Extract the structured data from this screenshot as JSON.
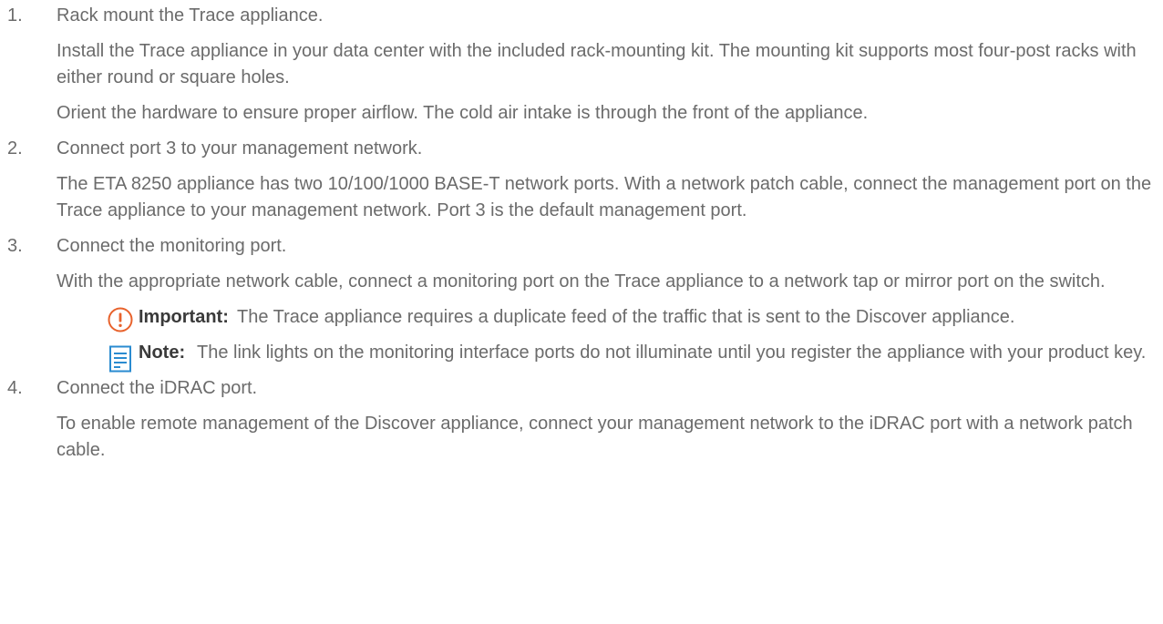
{
  "steps": [
    {
      "number": "1.",
      "title": "Rack mount the Trace appliance.",
      "paragraphs": [
        "Install the Trace appliance in your data center with the included rack-mounting kit. The mounting kit supports most four-post racks with either round or square holes.",
        "Orient the hardware to ensure proper airflow. The cold air intake is through the front of the appliance."
      ]
    },
    {
      "number": "2.",
      "title": "Connect port 3 to your management network.",
      "paragraphs": [
        "The ETA 8250 appliance has two 10/100/1000 BASE-T network ports. With a network patch cable, connect the management port on the Trace appliance to your management network. Port 3 is the default management port."
      ]
    },
    {
      "number": "3.",
      "title": "Connect the monitoring port.",
      "paragraphs": [
        "With the appropriate network cable, connect a monitoring port on the Trace appliance to a network tap or mirror port on the switch."
      ],
      "important": {
        "icon": "important-icon",
        "label": "Important:",
        "text": "The Trace appliance requires a duplicate feed of the traffic that is sent to the Discover appliance."
      },
      "note": {
        "icon": "note-icon",
        "label": "Note:",
        "text": "The link lights on the monitoring interface ports do not illuminate until you register the appliance with your product key."
      }
    },
    {
      "number": "4.",
      "title": "Connect the iDRAC port.",
      "paragraphs": [
        "To enable remote management of the Discover appliance, connect your management network to the iDRAC port with a network patch cable."
      ]
    }
  ],
  "colors": {
    "text": "#6b6b6b",
    "label": "#3a3a3a",
    "important_icon": "#e8622c",
    "note_icon": "#2a8bd0"
  }
}
